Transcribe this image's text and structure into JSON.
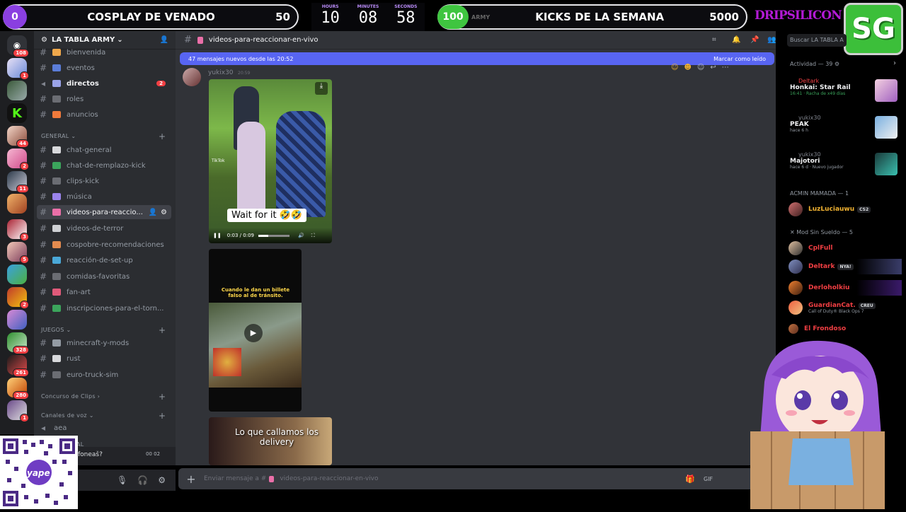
{
  "overlay": {
    "left_pill": {
      "badge": "0",
      "title": "COSPLAY DE VENADO",
      "value": "50"
    },
    "timer": {
      "hours_label": "HOURS",
      "minutes_label": "MINUTES",
      "seconds_label": "SECONDS",
      "hours": "10",
      "minutes": "08",
      "seconds": "58"
    },
    "right_pill": {
      "badge": "100",
      "title": "KICKS DE LA SEMANA",
      "value": "5000",
      "hidden_text": "ARMY"
    },
    "brand": {
      "text": "DRIPSILICON",
      "logo": "SG"
    },
    "qr_label": "yape"
  },
  "rail": {
    "pings": [
      "108",
      "1",
      "44",
      "2",
      "11",
      "3",
      "5",
      "2",
      "328",
      "261",
      "280",
      "1"
    ]
  },
  "sidebar": {
    "server_name": "LA TABLA ARMY",
    "channels_top": [
      {
        "name": "bienvenida",
        "emoji_color": "#f0a84b"
      },
      {
        "name": "eventos",
        "emoji_color": "#5b7dd8"
      },
      {
        "name": "directos",
        "emoji_color": "#9aa3e8",
        "bold": true,
        "badge": "2"
      },
      {
        "name": "roles",
        "emoji_color": "#6b6d73"
      },
      {
        "name": "anuncios",
        "emoji_color": "#f07a3b"
      }
    ],
    "cat_general": "GENERAL",
    "channels_general": [
      {
        "name": "chat-general",
        "emoji_color": "#d8d9dc"
      },
      {
        "name": "chat-de-remplazo-kick",
        "emoji_color": "#3ba55c"
      },
      {
        "name": "clips-kick",
        "emoji_color": "#6b6d73"
      },
      {
        "name": "música",
        "emoji_color": "#9b84ec"
      },
      {
        "name": "videos-para-reaccio...",
        "emoji_color": "#ea6fa8",
        "selected": true
      },
      {
        "name": "videos-de-terror",
        "emoji_color": "#cfd1d4"
      },
      {
        "name": "cospobre-recomendaciones",
        "emoji_color": "#e38b4f"
      },
      {
        "name": "reacción-de-set-up",
        "emoji_color": "#4aa8d8"
      },
      {
        "name": "comidas-favoritas",
        "emoji_color": "#6b6d73"
      },
      {
        "name": "fan-art",
        "emoji_color": "#e05a7a"
      },
      {
        "name": "inscripciones-para-el-torn...",
        "emoji_color": "#3ba55c"
      }
    ],
    "cat_juegos": "JUEGOS",
    "channels_juegos": [
      {
        "name": "minecraft-y-mods",
        "emoji_color": "#949ba4"
      },
      {
        "name": "rust",
        "emoji_color": "#d8d9dc"
      },
      {
        "name": "euro-truck-sim",
        "emoji_color": "#6b6d73"
      }
    ],
    "cat_clips": "Concurso de Clips",
    "cat_voz": "Canales de voz",
    "voice_channel": "aea",
    "cat_partial": "AL",
    "user_partial": "foneaš?",
    "user_counter": "00 02"
  },
  "chat": {
    "channel_name": "videos-para-reaccionar-en-vivo",
    "new_messages": "47 mensajes nuevos desde las 20:52",
    "mark_read": "Marcar como leído",
    "author": "yukix30",
    "time": "20:59",
    "video1": {
      "caption": "Wait for it 🤣🤣",
      "time": "0:03 / 0:09",
      "watermark": "TikTok"
    },
    "video2": {
      "caption": "Cuando le dan un billete falso al de tránsito."
    },
    "video3": {
      "caption": "Lo que callamos los delivery"
    },
    "composer_placeholder": "Enviar mensaje a #",
    "composer_channel": "videos-para-reaccionar-en-vivo",
    "search_placeholder": "Buscar LA TABLA A"
  },
  "members": {
    "activity_header": "Actividad — 39",
    "activities": [
      {
        "user": "Deltark",
        "game": "Honkai: Star Rail",
        "detail": "16:41 · Racha de x49 días",
        "user_color": "#f23f43"
      },
      {
        "user": "yukix30",
        "game": "PEAK",
        "detail": "hace 6 h",
        "user_color": "#80848e"
      },
      {
        "user": "yukix30",
        "game": "Majotori",
        "detail": "hace 6 d · Nuevo jugador",
        "user_color": "#80848e"
      }
    ],
    "group1": "ACMIN MAMADA — 1",
    "group1_members": [
      {
        "name": "LuzLuciauwu",
        "tag": "CS2",
        "color": "#f0b232"
      }
    ],
    "group2": "Mod Sin Sueldo — 5",
    "group2_members": [
      {
        "name": "CplFull",
        "tag": "",
        "color": "#f23f43"
      },
      {
        "name": "Deltark",
        "tag": "NYA!",
        "color": "#f23f43"
      },
      {
        "name": "Derloholkiu",
        "tag": "",
        "color": "#f23f43"
      },
      {
        "name": "GuardianCat.",
        "tag": "CREU",
        "color": "#f23f43",
        "sub": "Call of Duty® Black Ops 7"
      },
      {
        "name": "El Frondoso",
        "tag": "",
        "color": "#f23f43"
      }
    ]
  }
}
